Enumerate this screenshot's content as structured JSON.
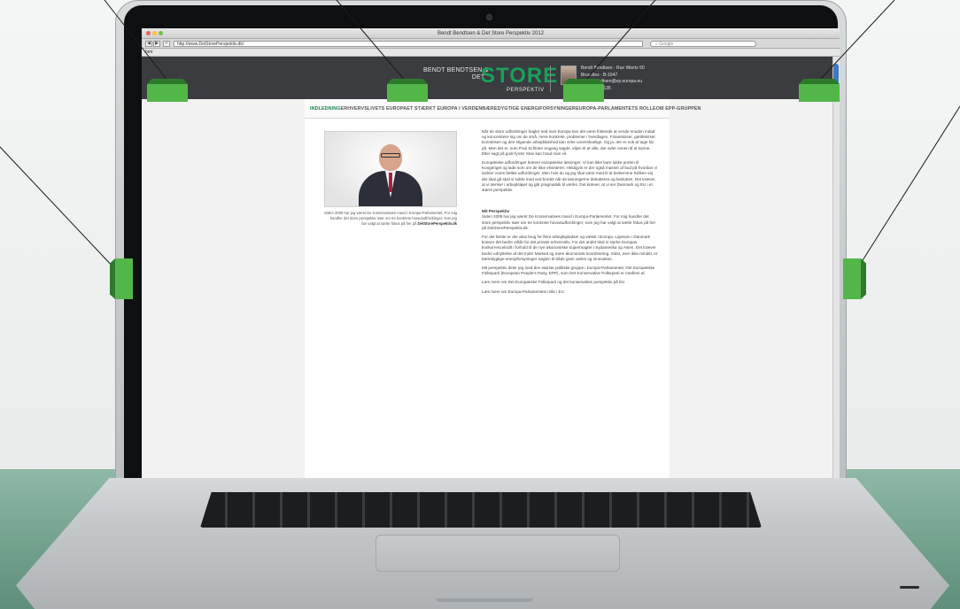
{
  "browser": {
    "window_title": "Bendt Bendtsen & Det Store Perspektiv 2012",
    "url": "http://www.DetStorePerspektiv.dk/",
    "search_placeholder": "Google",
    "bookmark_label": "bmt"
  },
  "site": {
    "brand_small_line1": "BENDT BENDTSEN &",
    "brand_small_line2": "DET",
    "brand_big": "STORE",
    "brand_sub": "PERSPEKTIV",
    "contact_lines": [
      "Bendt Bendtsen · Rue Wiertz 60",
      "Bruxelles · B-1047",
      "bendt.bendtsen@ep.europa.eu",
      "+32 228-45135"
    ]
  },
  "nav": {
    "items": [
      "INDLEDNING",
      "ERHVERVSLIVETS EUROPA",
      "ET STÆRKT EUROPA I VERDEN",
      "BÆREDYGTIGE ENERGIFORSYNINGER",
      "EUROPA-PARLAMENTETS ROLLE",
      "OM EPP-GRUPPEN"
    ]
  },
  "video_caption": {
    "text": "Siden 2009 har jeg været De Konservatives mand i Europa-Parlamentet. For mig handler det store perspektiv især om tre konkrete hovedudfordringer, som jeg har valgt at sætte fokus på her på",
    "site": "DetStorePerspektiv.dk"
  },
  "article": {
    "p1": "Når de store udfordringer hagler ned over Europa kan det være fristende at vende snuden indad og koncentrere sig om de små, mere konkrete, problemer i hverdagen. Finanskriser, gældskriser, Eurokrisen og den stigende arbejdsløshed kan virke uoverskuelige. Og ja, der er nok at tage fat på. Men det er, som Poul Schlüter engang sagde, viljen til at ville, der avler evnen til at kunne. Eller sagt på godt fynsk: Man kan hvad man vil.",
    "p2": "Europæiske udfordringer kræver europæiske løsninger. Vi kan ikke bare lukke porten til Kongeriget og lade som om de ikke eksisterer. Heldigvis er der også masser af bud på hvordan vi tackler vores fælles udfordringer. Men hvis du og jeg skal være med til at bestemme hvilken vej det skal gå skal vi sidde med ved bordet når de løsningerne debatteres og besluttes. Det kræver, at vi tænker i arbejdsløjet og går pragmatisk til værks. Det kræver, at vi ser Danmark og EU i et større perspektiv.",
    "h_mit": "Mit Perspektiv",
    "p3": "Siden 2009 har jeg været De Konservatives mand i Europa-Parlamentet. For mig handler det store perspektiv især om tre konkrete hovedudfordringer, som jeg har valgt at sætte fokus på her på DetStorePerspektiv.dk.",
    "p4": "For det første er der akut brug for flere arbejdspladser og vækst i Europa. Ligesom i Danmark kræver det bedre vilkår for det private erhvervsliv. For det andet skal vi styrke Europas konkurrencekraft i forhold til de nye økonomiske supermagter i Sydamerika og Asien. Det kræver bedre udnyttelse af det Indre Marked og mere økonomisk koordinering. Sidst, men ikke mindst, er bæredygtige energiforsyninger nøglen til både grøn vækst og innovation.",
    "p5": "Mit perspektiv deler jeg med den største politiske gruppe i Europa-Parlamentet, Det Europæiske Folkeparti (European People's Party, EPP), som Det Konservative Folkeparti er medlem af.",
    "p6": "Læs mere om Det Europæiske Folkeparti og det konservative perspektiv på EU",
    "p7": "Læs mere om Europa-Parlamentets rolle i EU"
  },
  "colors": {
    "callout_green": "#52b748",
    "brand_green": "#17a05a",
    "header_dark": "#3a3c40"
  }
}
